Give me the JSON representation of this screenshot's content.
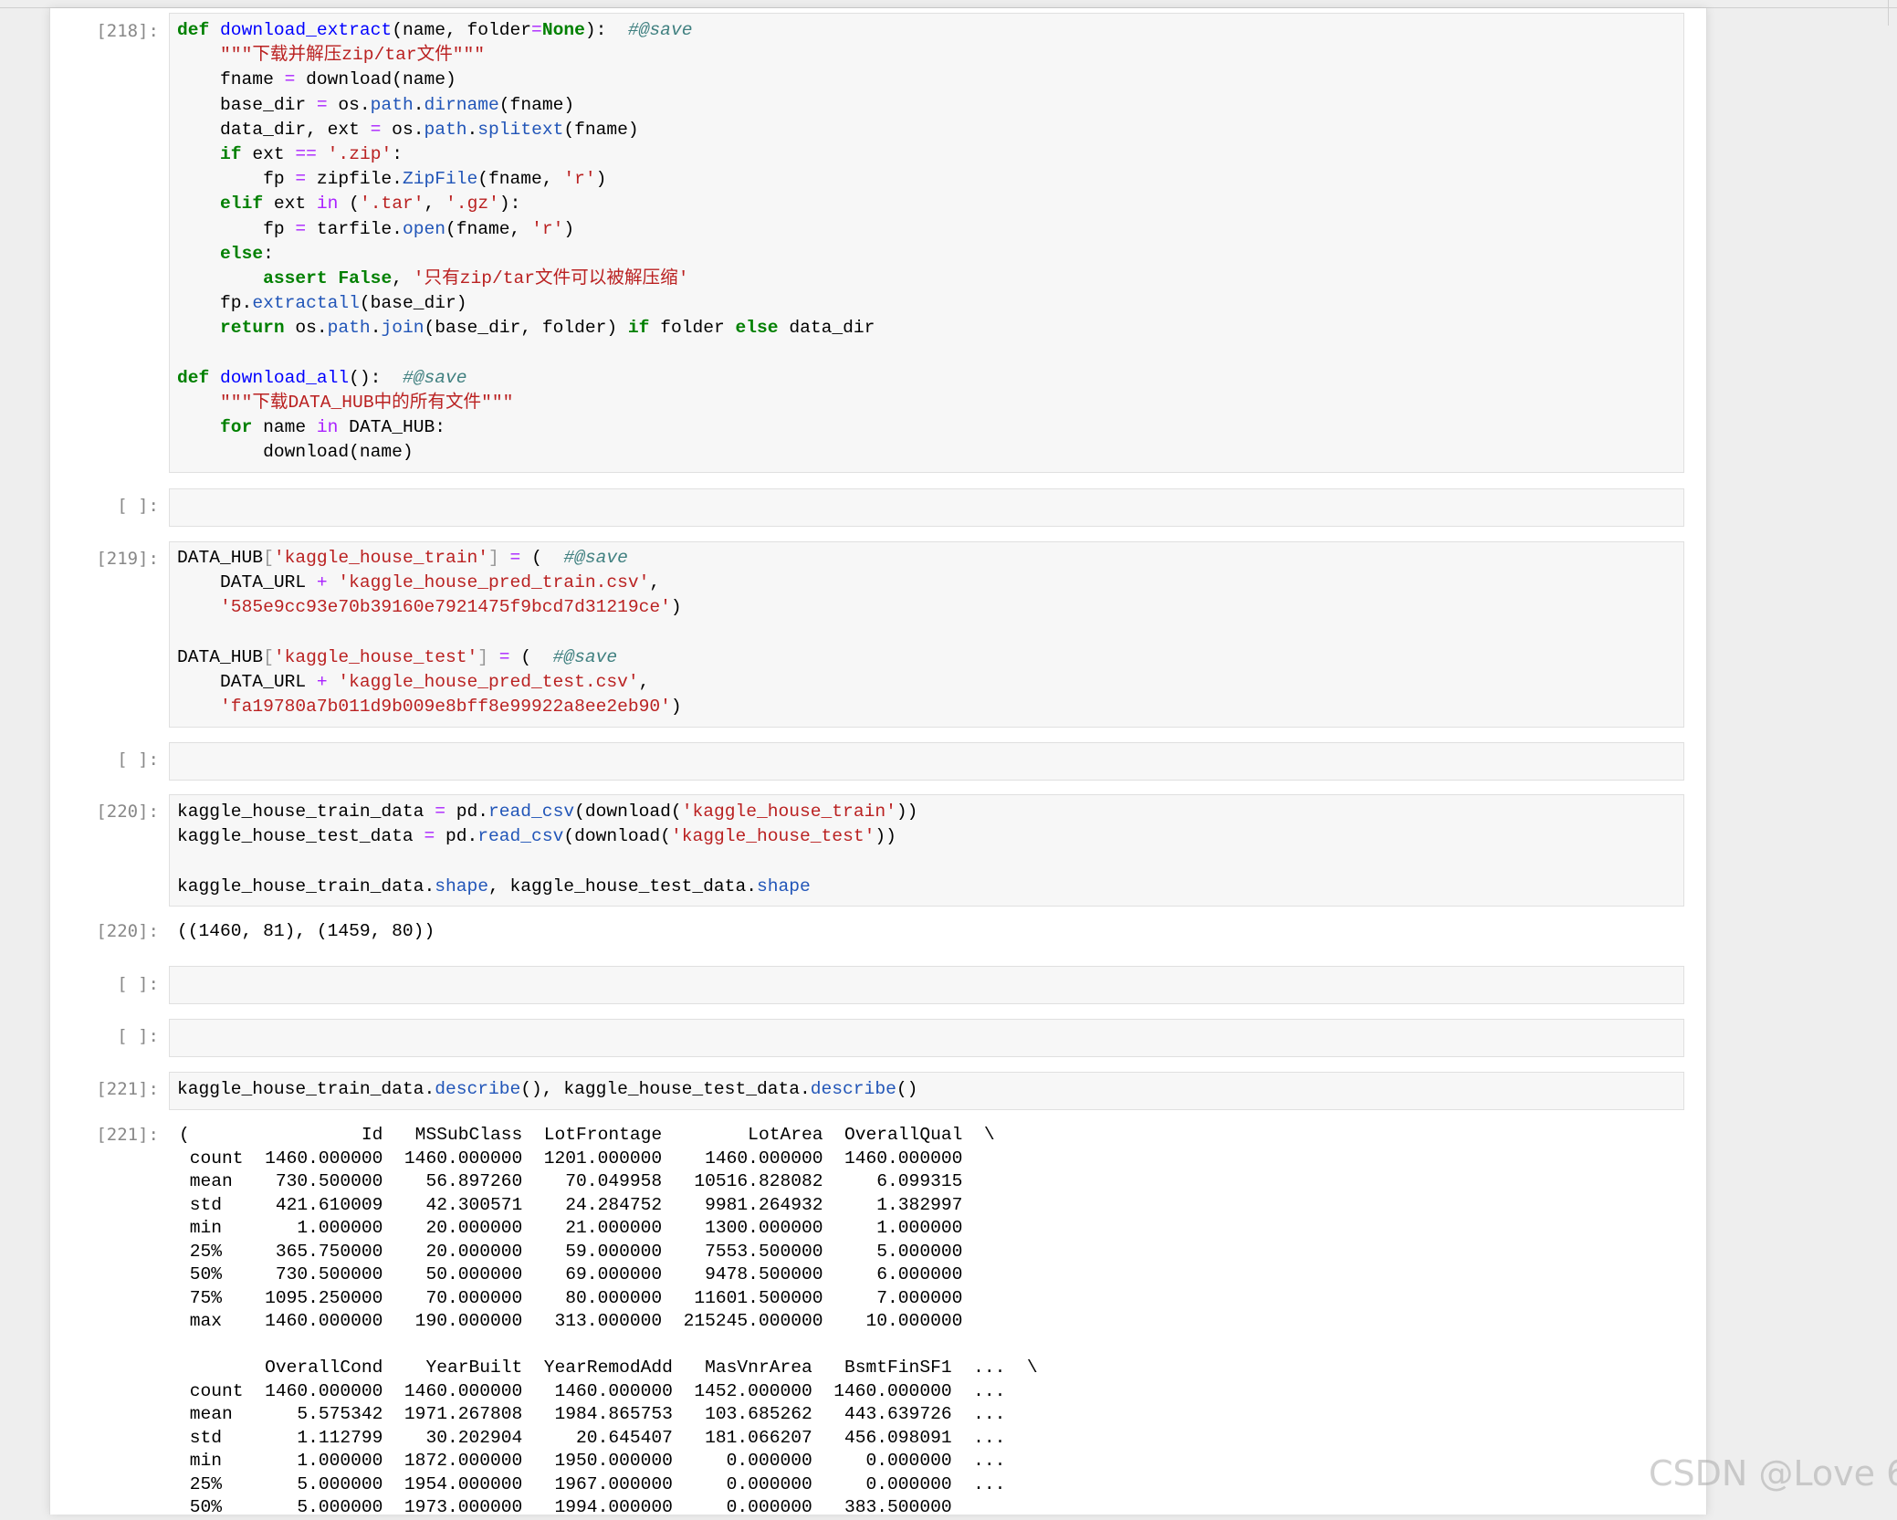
{
  "cells": [
    {
      "prompt": "[218]:",
      "kind": "input"
    },
    {
      "prompt": "[ ]:",
      "kind": "input"
    },
    {
      "prompt": "[219]:",
      "kind": "input"
    },
    {
      "prompt": "[ ]:",
      "kind": "input"
    },
    {
      "prompt": "[220]:",
      "kind": "input"
    },
    {
      "prompt": "[220]:",
      "kind": "output",
      "text": "((1460, 81), (1459, 80))"
    },
    {
      "prompt": "[ ]:",
      "kind": "input"
    },
    {
      "prompt": "[ ]:",
      "kind": "input"
    },
    {
      "prompt": "[221]:",
      "kind": "input"
    },
    {
      "prompt": "[221]:",
      "kind": "output"
    }
  ],
  "code": {
    "cell218": [
      [
        [
          "k",
          "def"
        ],
        [
          "",
          "·"
        ],
        [
          "f",
          "download_extract"
        ],
        [
          "",
          "(name, folder"
        ],
        [
          "o",
          "="
        ],
        [
          "k",
          "None"
        ],
        [
          "",
          "):  "
        ],
        [
          "c",
          "#@save"
        ]
      ],
      [
        [
          "",
          "    "
        ],
        [
          "s",
          "\"\"\"下载并解压zip/tar文件\"\"\""
        ]
      ],
      [
        [
          "",
          "    fname "
        ],
        [
          "o",
          "="
        ],
        [
          "",
          ""
        ],
        [
          "",
          ""
        ],
        [
          "",
          "·download(name)"
        ]
      ],
      [
        [
          "",
          "    base_dir "
        ],
        [
          "o",
          "="
        ],
        [
          "",
          "·os."
        ],
        [
          "a",
          "path"
        ],
        [
          "",
          "."
        ],
        [
          "a",
          "dirname"
        ],
        [
          "",
          "(fname)"
        ]
      ],
      [
        [
          "",
          "    data_dir, ext "
        ],
        [
          "o",
          "="
        ],
        [
          "",
          "·os."
        ],
        [
          "a",
          "path"
        ],
        [
          "",
          "."
        ],
        [
          "a",
          "splitext"
        ],
        [
          "",
          "(fname)"
        ]
      ],
      [
        [
          "",
          "    "
        ],
        [
          "k",
          "if"
        ],
        [
          "",
          "·ext "
        ],
        [
          "o",
          "=="
        ],
        [
          "",
          "·"
        ],
        [
          "s",
          "'.zip'"
        ],
        [
          "",
          ":"
        ]
      ],
      [
        [
          "",
          "        fp "
        ],
        [
          "o",
          "="
        ],
        [
          "",
          "·zipfile."
        ],
        [
          "a",
          "ZipFile"
        ],
        [
          "",
          "(fname, "
        ],
        [
          "s",
          "'r'"
        ],
        [
          "",
          ")"
        ]
      ],
      [
        [
          "",
          "    "
        ],
        [
          "k",
          "elif"
        ],
        [
          "",
          "·ext "
        ],
        [
          "o",
          "in"
        ],
        [
          "",
          "·("
        ],
        [
          "s",
          "'.tar'"
        ],
        [
          "",
          ", "
        ],
        [
          "s",
          "'.gz'"
        ],
        [
          "",
          "):"
        ]
      ],
      [
        [
          "",
          "        fp "
        ],
        [
          "o",
          "="
        ],
        [
          "",
          "·tarfile."
        ],
        [
          "a",
          "open"
        ],
        [
          "",
          "(fname, "
        ],
        [
          "s",
          "'r'"
        ],
        [
          "",
          ")"
        ]
      ],
      [
        [
          "",
          "    "
        ],
        [
          "k",
          "else"
        ],
        [
          "",
          ":"
        ]
      ],
      [
        [
          "",
          "        "
        ],
        [
          "k",
          "assert"
        ],
        [
          "",
          "·"
        ],
        [
          "k",
          "False"
        ],
        [
          "",
          ", "
        ],
        [
          "s",
          "'只有zip/tar文件可以被解压缩'"
        ]
      ],
      [
        [
          "",
          "    fp."
        ],
        [
          "a",
          "extractall"
        ],
        [
          "",
          "(base_dir)"
        ]
      ],
      [
        [
          "",
          "    "
        ],
        [
          "k",
          "return"
        ],
        [
          "",
          "·os."
        ],
        [
          "a",
          "path"
        ],
        [
          "",
          "."
        ],
        [
          "a",
          "join"
        ],
        [
          "",
          "(base_dir, folder) "
        ],
        [
          "k",
          "if"
        ],
        [
          "",
          "·folder "
        ],
        [
          "k",
          "else"
        ],
        [
          "",
          "·data_dir"
        ]
      ],
      [],
      [
        [
          "k",
          "def"
        ],
        [
          "",
          "·"
        ],
        [
          "f",
          "download_all"
        ],
        [
          "",
          "():  "
        ],
        [
          "c",
          "#@save"
        ]
      ],
      [
        [
          "",
          "    "
        ],
        [
          "s",
          "\"\"\"下载DATA_HUB中的所有文件\"\"\""
        ]
      ],
      [
        [
          "",
          "    "
        ],
        [
          "k",
          "for"
        ],
        [
          "",
          "·name "
        ],
        [
          "o",
          "in"
        ],
        [
          "",
          "·DATA_HUB:"
        ]
      ],
      [
        [
          "",
          "        download(name)"
        ]
      ]
    ],
    "cell219": [
      [
        [
          "",
          "DATA_HUB"
        ],
        [
          "bk",
          "["
        ],
        [
          "s",
          "'kaggle_house_train'"
        ],
        [
          "bk",
          "]"
        ],
        [
          "",
          "·"
        ],
        [
          "o",
          "="
        ],
        [
          "",
          "·(  "
        ],
        [
          "c",
          "#@save"
        ]
      ],
      [
        [
          "",
          "    DATA_URL "
        ],
        [
          "o",
          "+"
        ],
        [
          "",
          "·"
        ],
        [
          "s",
          "'kaggle_house_pred_train.csv'"
        ],
        [
          "",
          ","
        ]
      ],
      [
        [
          "",
          "    "
        ],
        [
          "s",
          "'585e9cc93e70b39160e7921475f9bcd7d31219ce'"
        ],
        [
          "",
          ")"
        ]
      ],
      [],
      [
        [
          "",
          "DATA_HUB"
        ],
        [
          "bk",
          "["
        ],
        [
          "s",
          "'kaggle_house_test'"
        ],
        [
          "bk",
          "]"
        ],
        [
          "",
          "·"
        ],
        [
          "o",
          "="
        ],
        [
          "",
          "·(  "
        ],
        [
          "c",
          "#@save"
        ]
      ],
      [
        [
          "",
          "    DATA_URL "
        ],
        [
          "o",
          "+"
        ],
        [
          "",
          "·"
        ],
        [
          "s",
          "'kaggle_house_pred_test.csv'"
        ],
        [
          "",
          ","
        ]
      ],
      [
        [
          "",
          "    "
        ],
        [
          "s",
          "'fa19780a7b011d9b009e8bff8e99922a8ee2eb90'"
        ],
        [
          "",
          ")"
        ]
      ]
    ],
    "cell220": [
      [
        [
          "",
          "kaggle_house_train_data "
        ],
        [
          "o",
          "="
        ],
        [
          "",
          "·pd."
        ],
        [
          "a",
          "read_csv"
        ],
        [
          "",
          "(download("
        ],
        [
          "s",
          "'kaggle_house_train'"
        ],
        [
          "",
          "))"
        ]
      ],
      [
        [
          "",
          "kaggle_house_test_data "
        ],
        [
          "o",
          "="
        ],
        [
          "",
          "·pd."
        ],
        [
          "a",
          "read_csv"
        ],
        [
          "",
          "(download("
        ],
        [
          "s",
          "'kaggle_house_test'"
        ],
        [
          "",
          "))"
        ]
      ],
      [],
      [
        [
          "",
          "kaggle_house_train_data."
        ],
        [
          "a",
          "shape"
        ],
        [
          "",
          ", kaggle_house_test_data."
        ],
        [
          "a",
          "shape"
        ]
      ]
    ],
    "cell221": [
      [
        [
          "",
          "kaggle_house_train_data."
        ],
        [
          "a",
          "describe"
        ],
        [
          "",
          "(), kaggle_house_test_data."
        ],
        [
          "a",
          "describe"
        ],
        [
          "",
          "()"
        ]
      ]
    ]
  },
  "describe_output": [
    "(                Id   MSSubClass  LotFrontage        LotArea  OverallQual  \\",
    " count  1460.000000  1460.000000  1201.000000    1460.000000  1460.000000",
    " mean    730.500000    56.897260    70.049958   10516.828082     6.099315",
    " std     421.610009    42.300571    24.284752    9981.264932     1.382997",
    " min       1.000000    20.000000    21.000000    1300.000000     1.000000",
    " 25%     365.750000    20.000000    59.000000    7553.500000     5.000000",
    " 50%     730.500000    50.000000    69.000000    9478.500000     6.000000",
    " 75%    1095.250000    70.000000    80.000000   11601.500000     7.000000",
    " max    1460.000000   190.000000   313.000000  215245.000000    10.000000",
    "",
    "        OverallCond    YearBuilt  YearRemodAdd   MasVnrArea   BsmtFinSF1  ...  \\",
    " count  1460.000000  1460.000000   1460.000000  1452.000000  1460.000000  ...",
    " mean      5.575342  1971.267808   1984.865753   103.685262   443.639726  ...",
    " std       1.112799    30.202904     20.645407   181.066207   456.098091  ...",
    " min       1.000000  1872.000000   1950.000000     0.000000     0.000000  ...",
    " 25%       5.000000  1954.000000   1967.000000     0.000000     0.000000  ...",
    " 50%       5.000000  1973.000000   1994.000000     0.000000   383.500000"
  ],
  "watermark": "CSDN @Love 6",
  "colors": {
    "keyword": "#008000",
    "function": "#0000ff",
    "attribute": "#2155b8",
    "string": "#ba2121",
    "comment": "#408080",
    "operator": "#aa22ff",
    "prompt": "#888888",
    "cell_bg": "#f7f7f7"
  }
}
